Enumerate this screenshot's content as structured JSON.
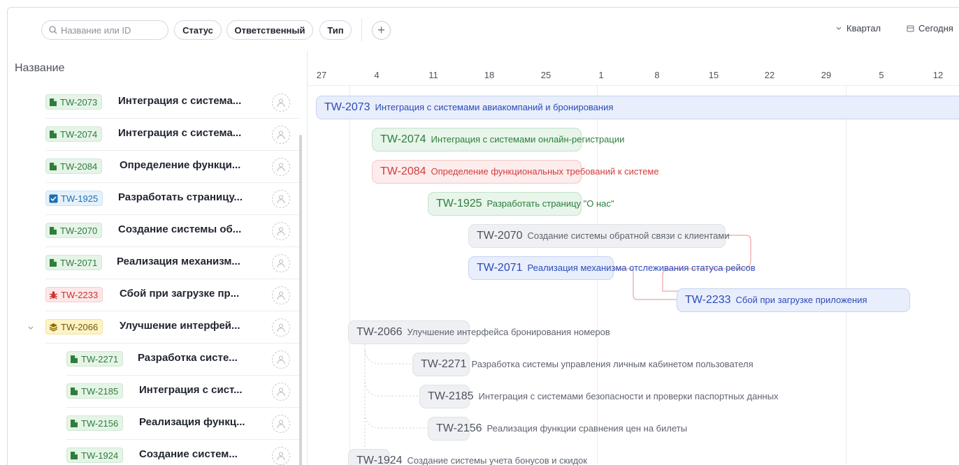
{
  "toolbar": {
    "search_placeholder": "Название или ID",
    "filters": [
      "Статус",
      "Ответственный",
      "Тип"
    ],
    "add_label": "+",
    "scale_label": "Квартал",
    "today_label": "Сегодня"
  },
  "list": {
    "header": "Название",
    "rows": [
      {
        "type": "story",
        "id": "TW-2073",
        "title": "Интеграция с система...",
        "level": 0
      },
      {
        "type": "story",
        "id": "TW-2074",
        "title": "Интеграция с система...",
        "level": 0
      },
      {
        "type": "story",
        "id": "TW-2084",
        "title": "Определение функци...",
        "level": 0
      },
      {
        "type": "task",
        "id": "TW-1925",
        "title": "Разработать страницу...",
        "level": 0
      },
      {
        "type": "story",
        "id": "TW-2070",
        "title": "Создание системы об...",
        "level": 0
      },
      {
        "type": "story",
        "id": "TW-2071",
        "title": "Реализация механизм...",
        "level": 0
      },
      {
        "type": "bug",
        "id": "TW-2233",
        "title": "Сбой при загрузке пр...",
        "level": 0
      },
      {
        "type": "epic",
        "id": "TW-2066",
        "title": "Улучшение интерфей...",
        "level": 0,
        "expanded": true
      },
      {
        "type": "story",
        "id": "TW-2271",
        "title": "Разработка систе...",
        "level": 1
      },
      {
        "type": "story",
        "id": "TW-2185",
        "title": "Интеграция с сист...",
        "level": 1
      },
      {
        "type": "story",
        "id": "TW-2156",
        "title": "Реализация функц...",
        "level": 1
      },
      {
        "type": "story",
        "id": "TW-1924",
        "title": "Создание систем...",
        "level": 1
      }
    ]
  },
  "timeline": {
    "ticks": [
      "27",
      "4",
      "11",
      "18",
      "25",
      "1",
      "8",
      "15",
      "22",
      "29",
      "5",
      "12"
    ],
    "bars": [
      {
        "id": "TW-2073",
        "name": "Интеграция с системами авиакомпаний и бронирования",
        "color": "blue"
      },
      {
        "id": "TW-2074",
        "name": "Интеграция с системами онлайн-регистрации",
        "color": "green"
      },
      {
        "id": "TW-2084",
        "name": "Определение функциональных требований к системе",
        "color": "red"
      },
      {
        "id": "TW-1925",
        "name": "Разработать страницу \"О нас\"",
        "color": "green"
      },
      {
        "id": "TW-2070",
        "name": "Создание системы обратной связи с клиентами",
        "color": "grey"
      },
      {
        "id": "TW-2071",
        "name": "Реализация механизма отслеживания статуса рейсов",
        "color": "blue"
      },
      {
        "id": "TW-2233",
        "name": "Сбой при загрузке приложения",
        "color": "blue"
      },
      {
        "id": "TW-2066",
        "name": "Улучшение интерфейса бронирования номеров",
        "color": "grey"
      },
      {
        "id": "TW-2271",
        "name": "Разработка системы управления личным кабинетом пользователя",
        "color": "grey"
      },
      {
        "id": "TW-2185",
        "name": "Интеграция с системами безопасности и проверки паспортных данных",
        "color": "grey"
      },
      {
        "id": "TW-2156",
        "name": "Реализация функции сравнения цен на билеты",
        "color": "grey"
      },
      {
        "id": "TW-1924",
        "name": "Создание системы учета бонусов и скидок",
        "color": "grey"
      }
    ]
  }
}
